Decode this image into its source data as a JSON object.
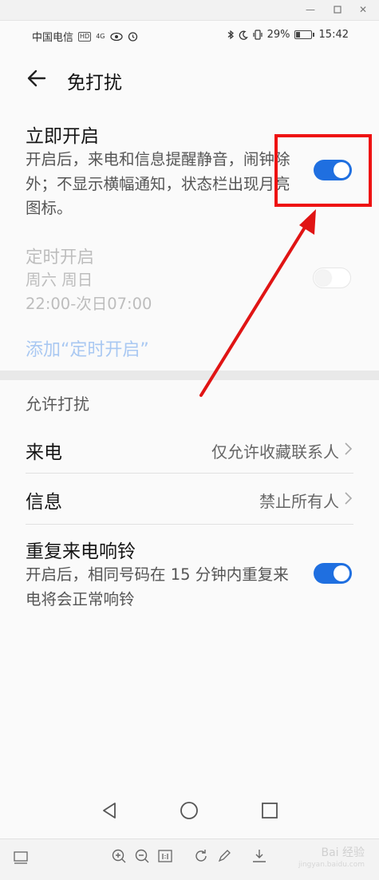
{
  "status_bar": {
    "carrier": "中国电信",
    "hd_badge": "HD",
    "signal_badge": "4G",
    "battery_percent": "29%",
    "time": "15:42"
  },
  "header": {
    "title": "免打扰"
  },
  "immediate": {
    "label": "立即开启",
    "description": "开启后，来电和信息提醒静音，闹钟除外；不显示横幅通知，状态栏出现月亮图标。",
    "toggle_on": true
  },
  "scheduled": {
    "label": "定时开启",
    "days": "周六 周日",
    "time_range": "22:00-次日07:00",
    "toggle_on": false
  },
  "add_schedule_link": "添加“定时开启”",
  "allow_section": {
    "title": "允许打扰",
    "items": [
      {
        "label": "来电",
        "value": "仅允许收藏联系人"
      },
      {
        "label": "信息",
        "value": "禁止所有人"
      }
    ]
  },
  "repeat_calls": {
    "label": "重复来电响铃",
    "description": "开启后，相同号码在 15 分钟内重复来电将会正常响铃",
    "toggle_on": true
  },
  "watermark": {
    "line1": "Bai 经验",
    "line2": "jingyan.baidu.com"
  },
  "colors": {
    "accent": "#1f6fe0",
    "annotation": "#ee1111"
  },
  "icons": [
    "minimize-icon",
    "restore-icon",
    "close-icon",
    "back-arrow-icon",
    "chevron-right-icon",
    "nav-back-icon",
    "nav-home-icon",
    "nav-recents-icon",
    "zoom-in-icon",
    "zoom-out-icon",
    "actual-size-icon",
    "rotate-icon",
    "edit-icon",
    "download-icon"
  ]
}
